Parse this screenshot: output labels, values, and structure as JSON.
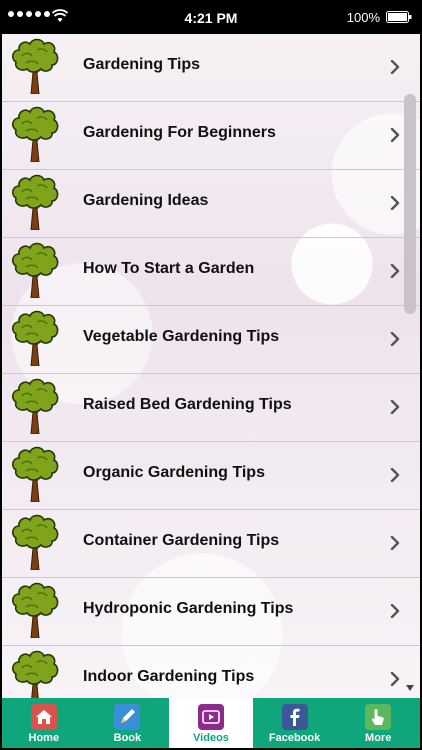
{
  "status_bar": {
    "time": "4:21 PM",
    "battery": "100%",
    "signal_icon": "signal-dots-icon",
    "wifi_icon": "wifi-icon",
    "battery_icon": "battery-icon"
  },
  "list": {
    "items": [
      {
        "label": "Gardening Tips"
      },
      {
        "label": "Gardening For Beginners"
      },
      {
        "label": "Gardening Ideas"
      },
      {
        "label": "How To Start a Garden"
      },
      {
        "label": "Vegetable Gardening Tips"
      },
      {
        "label": "Raised Bed Gardening Tips"
      },
      {
        "label": "Organic Gardening Tips"
      },
      {
        "label": "Container Gardening Tips"
      },
      {
        "label": "Hydroponic Gardening Tips"
      },
      {
        "label": "Indoor Gardening Tips"
      }
    ],
    "item_icon": "tree-icon",
    "chevron_icon": "chevron-right-icon"
  },
  "tabbar": {
    "tabs": [
      {
        "label": "Home",
        "icon": "home-icon",
        "color": "#d9534f"
      },
      {
        "label": "Book",
        "icon": "book-pencil-icon",
        "color": "#3b8fd9"
      },
      {
        "label": "Videos",
        "icon": "video-play-icon",
        "color": "#8e2a8e"
      },
      {
        "label": "Facebook",
        "icon": "facebook-icon",
        "color": "#3b5998"
      },
      {
        "label": "More",
        "icon": "hand-pointer-icon",
        "color": "#5cb85c"
      }
    ],
    "active_index": 2,
    "bar_color": "#0fa67b"
  }
}
